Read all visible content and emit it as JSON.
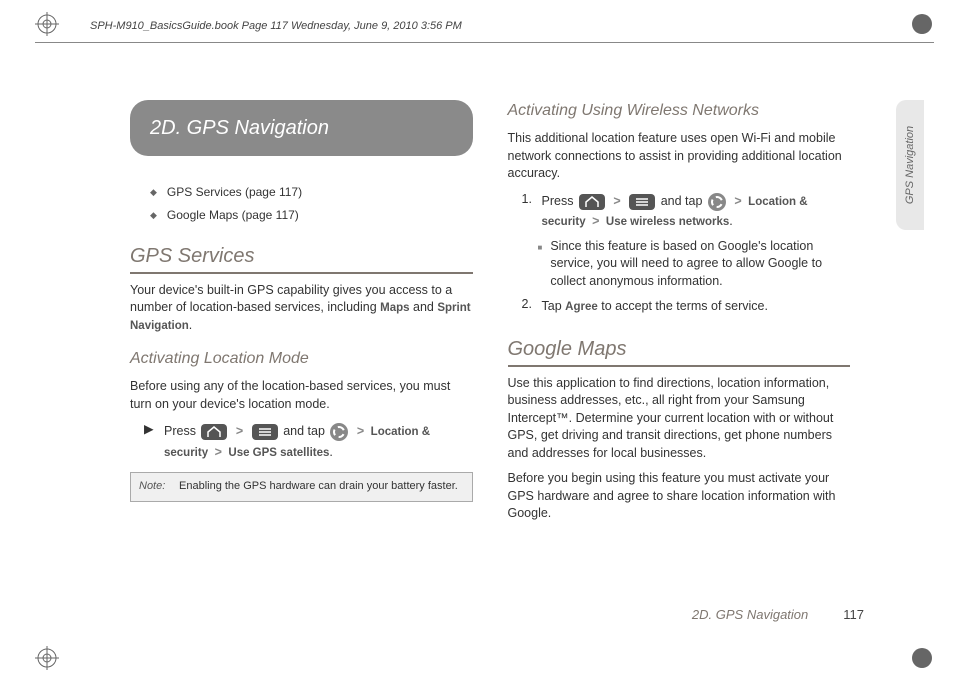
{
  "header": {
    "runningHeader": "SPH-M910_BasicsGuide.book  Page 117  Wednesday, June 9, 2010  3:56 PM"
  },
  "sectionPill": "2D.  GPS Navigation",
  "toc": [
    "GPS Services (page 117)",
    "Google Maps (page 117)"
  ],
  "gpsServices": {
    "heading": "GPS Services",
    "intro_a": "Your device's built-in GPS capability gives you access to a number of location-based services, including ",
    "intro_b": "Maps",
    "intro_c": " and ",
    "intro_d": "Sprint Navigation",
    "intro_e": ".",
    "activating": {
      "heading": "Activating Location Mode",
      "intro": "Before using any of the location-based services, you must turn on your device's location mode.",
      "step_press": "Press ",
      "step_andtap": " and tap ",
      "step_trail_a": "Location & security",
      "step_trail_b": "Use GPS satellites",
      "note_label": "Note:",
      "note_text": "Enabling the GPS hardware can drain your battery faster."
    }
  },
  "wireless": {
    "heading": "Activating Using Wireless Networks",
    "intro": "This additional location feature uses open Wi-Fi and mobile network connections to assist in providing additional location accuracy.",
    "step1_num": "1.",
    "step1_press": "Press ",
    "step1_andtap": " and tap ",
    "step1_trail_a": "Location & security",
    "step1_trail_b": "Use wireless networks",
    "step1_sub": "Since this feature is based on Google's location service, you will need to agree to allow Google to collect anonymous information.",
    "step2_num": "2.",
    "step2_a": "Tap ",
    "step2_b": "Agree",
    "step2_c": " to accept the terms of service."
  },
  "googleMaps": {
    "heading": "Google Maps",
    "p1": "Use this application to find directions, location information, business addresses, etc., all right from your Samsung Intercept™. Determine your current location with or without GPS, get driving and transit directions, get phone numbers and addresses for local businesses.",
    "p2": "Before you begin using this feature you must activate your GPS hardware and agree to share location information with Google."
  },
  "sideTab": "GPS Navigation",
  "footer": {
    "section": "2D. GPS Navigation",
    "page": "117"
  },
  "glyphs": {
    "gt": ">",
    "period": "."
  }
}
